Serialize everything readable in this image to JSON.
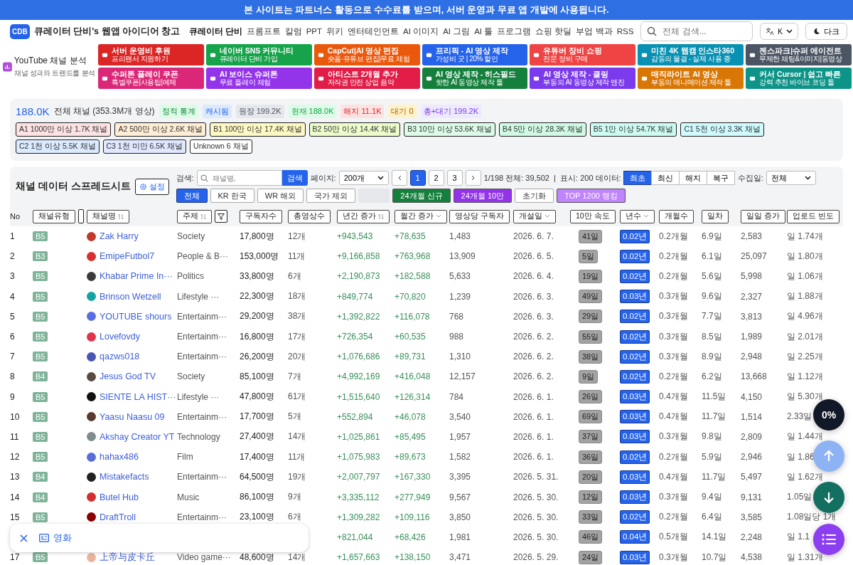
{
  "banner": "본 사이트는 파트너스 활동으로 수수료를 받으며, 서버 운영과 무료 앱 개발에 사용됩니다.",
  "nav": {
    "logo": "CDB",
    "title": "큐레이터 단비's 웹앱 아이디어 창고",
    "links": [
      {
        "label": "큐레이터 단비",
        "bold": true
      },
      {
        "label": "프롬프트",
        "bold": false
      },
      {
        "label": "칼럼",
        "bold": false
      },
      {
        "label": "PPT",
        "bold": false
      },
      {
        "label": "위키",
        "bold": false
      },
      {
        "label": "엔터테인먼트",
        "bold": false
      },
      {
        "label": "AI 이미지",
        "bold": false
      },
      {
        "label": "AI 그림",
        "bold": false
      },
      {
        "label": "AI 툴",
        "bold": false
      },
      {
        "label": "프로그램",
        "bold": false
      },
      {
        "label": "쇼핑 핫딜",
        "bold": false
      },
      {
        "label": "부업 백과",
        "bold": false
      },
      {
        "label": "RSS",
        "bold": false
      }
    ],
    "search_placeholder": "전체 검색...",
    "language": "K",
    "theme_button": "다크"
  },
  "app_card": {
    "title": "YouTube 채널 분석",
    "subtitle": "채널 성과와 트렌드를 분석"
  },
  "promos": [
    {
      "title": "서버 운영비 후원",
      "subtitle": "프리랜서 지원하기",
      "color": "#dc2626"
    },
    {
      "title": "네이버 SNS 커뮤니티",
      "subtitle": "큐레이터 단비 가입",
      "color": "#16a34a"
    },
    {
      "title": "CapCut|AI 영상 편집",
      "subtitle": "숏폼·유튜브 편집|무료 체험",
      "color": "#ea580c"
    },
    {
      "title": "프리픽 - AI 영상 제작",
      "subtitle": "가성비 굿 | 20% 할인",
      "color": "#2563eb"
    },
    {
      "title": "유튜버 장비 쇼핑",
      "subtitle": "전문 장비 구매",
      "color": "#ef4444"
    },
    {
      "title": "미친 4K 웹캠 인스타360",
      "subtitle": "감동의 물결 - 실제 사용 중",
      "color": "#0891b2"
    },
    {
      "title": "젠스파크|슈퍼 에이전트",
      "subtitle": "무제한 채팅&이미지|동영상",
      "color": "#4b5563"
    },
    {
      "title": "수퍼톤 플레이 쿠폰",
      "subtitle": "특별쿠폰|사용팁|예제",
      "color": "#db2777"
    },
    {
      "title": "AI 보이스 슈퍼톤",
      "subtitle": "무료 플레이 체험",
      "color": "#9333ea"
    },
    {
      "title": "아티스트 2개월 추가",
      "subtitle": "저작권 안전 상업 음악",
      "color": "#e11d48"
    },
    {
      "title": "AI 영상 제작 - 히스필드",
      "subtitle": "핫한 AI 동영상 제작 툴",
      "color": "#15803d"
    },
    {
      "title": "AI 영상 제작 - 클링",
      "subtitle": "부동의 AI 동영상 제작 엔진",
      "color": "#7c3aed"
    },
    {
      "title": "매직라이트 AI 영상",
      "subtitle": "부동의 애니메이션 제작 툴",
      "color": "#d97706"
    },
    {
      "title": "커서 Cursor | 쉽고 빠른",
      "subtitle": "강력 추천 바이브 코딩 툴",
      "color": "#0d9488"
    }
  ],
  "stats": {
    "total": "188.0K",
    "total_label": "전체 채널 (353.3M개 영상)",
    "chips": [
      {
        "label": "정적 통계",
        "kind": "static"
      },
      {
        "label": "캐시됨",
        "kind": "cache"
      },
      {
        "label": "원장 199.2K",
        "kind": "ledger"
      },
      {
        "label": "현재 188.0K",
        "kind": "current"
      },
      {
        "label": "해지 11.1K",
        "kind": "cancelled"
      },
      {
        "label": "대기 0",
        "kind": "waiting"
      },
      {
        "label": "총+대기 199.2K",
        "kind": "total"
      }
    ],
    "grades": [
      {
        "label": "A1 1000만 이상 1.7K 채널",
        "color": "#fde2e2"
      },
      {
        "label": "A2 500만 이상 2.6K 채널",
        "color": "#ffedd5"
      },
      {
        "label": "B1 100만 이상 17.4K 채널",
        "color": "#fef9c3"
      },
      {
        "label": "B2 50만 이상 14.4K 채널",
        "color": "#ecfccb"
      },
      {
        "label": "B3 10만 이상 53.6K 채널",
        "color": "#dcfce7"
      },
      {
        "label": "B4 5만 이상 28.3K 채널",
        "color": "#d1fae5"
      },
      {
        "label": "B5 1만 이상 54.7K 채널",
        "color": "#ccfbf1"
      },
      {
        "label": "C1 5천 이상 3.3K 채널",
        "color": "#cffafe"
      },
      {
        "label": "C2 1천 이상 5.5K 채널",
        "color": "#dbeafe"
      },
      {
        "label": "C3 1천 미만 6.5K 채널",
        "color": "#e0e7ff"
      },
      {
        "label": "Unknown 6 채널",
        "color": "#ffffff"
      }
    ]
  },
  "controls": {
    "title": "채널 데이터 스프레드시트",
    "settings": "설정",
    "search_label": "검색:",
    "search_placeholder": "채널명, ",
    "search_button": "검색",
    "page_size_label": "페이지:",
    "page_size": "200개",
    "pages": [
      {
        "label": "1",
        "selected": true
      },
      {
        "label": "2",
        "selected": false
      },
      {
        "label": "3",
        "selected": false
      }
    ],
    "page_info": "1/198 전체: 39,502  |  표시: 200 데이터:",
    "modes": [
      {
        "label": "최초",
        "selected": true
      },
      {
        "label": "최신",
        "selected": false
      },
      {
        "label": "해지",
        "selected": false
      },
      {
        "label": "복구",
        "selected": false
      }
    ],
    "collect_label": "수집일:",
    "collect": "전체",
    "filters": [
      {
        "kind": "plain",
        "label": "전체",
        "selected": true
      },
      {
        "kind": "plain",
        "label": "KR 한국",
        "selected": false
      },
      {
        "kind": "plain",
        "label": "WR 해외",
        "selected": false
      },
      {
        "kind": "plain",
        "label": "국가 제외",
        "selected": false
      },
      {
        "kind": "disabled"
      },
      {
        "kind": "solid",
        "label": "24개월 신규",
        "color": "#15803d"
      },
      {
        "kind": "solid",
        "label": "24개월 10만",
        "color": "#9333ea"
      },
      {
        "kind": "plain",
        "label": "초기화",
        "selected": false
      },
      {
        "kind": "solid",
        "label": "TOP 1200 랭킹",
        "color": "#c084fc"
      }
    ]
  },
  "table": {
    "columns": [
      {
        "label": "No",
        "kind": "plain"
      },
      {
        "label": "채널유형",
        "kind": "button",
        "toggle": true
      },
      {
        "label": "채널명",
        "kind": "button",
        "sortable": true
      },
      {
        "label": "주제",
        "kind": "button",
        "sortable": true,
        "filter": true
      },
      {
        "label": "구독자수",
        "kind": "button"
      },
      {
        "label": "총영상수",
        "kind": "button"
      },
      {
        "label": "년간 증가",
        "kind": "button",
        "sortable": true
      },
      {
        "label": "월간 증가",
        "kind": "button",
        "dropdown": true
      },
      {
        "label": "영상당 구독자",
        "kind": "button"
      },
      {
        "label": "개설일",
        "kind": "button",
        "dropdown": true
      },
      {
        "label": "10만 속도",
        "kind": "button"
      },
      {
        "label": "년수",
        "kind": "button",
        "dropdown": true
      },
      {
        "label": "개월수",
        "kind": "button"
      },
      {
        "label": "일차",
        "kind": "button"
      },
      {
        "label": "일일 증가",
        "kind": "button"
      },
      {
        "label": "업로드 빈도",
        "kind": "button"
      }
    ],
    "rows": [
      {
        "no": "1",
        "grade": "B5",
        "color": "#c0392b",
        "name": "Zak Harry",
        "topic": "Society",
        "subs": "17,800명",
        "videos": "12개",
        "yearly": "+943,543",
        "monthly": "+78,635",
        "per_video": "1,483",
        "opened": "2026. 6. 7.",
        "speed": "41일",
        "years": "0.02년",
        "months": "0.2개월",
        "days": "6.9일",
        "daily": "2,583",
        "upload": "일 1.74개"
      },
      {
        "no": "2",
        "grade": "B3",
        "color": "#d63031",
        "name": "EmipeFutbol7",
        "topic": "People & B···",
        "subs": "153,000명",
        "videos": "11개",
        "yearly": "+9,166,858",
        "monthly": "+763,968",
        "per_video": "13,909",
        "opened": "2026. 6. 5.",
        "speed": "5일",
        "years": "0.02년",
        "months": "0.2개월",
        "days": "6.1일",
        "daily": "25,097",
        "upload": "일 1.80개"
      },
      {
        "no": "3",
        "grade": "B5",
        "color": "#3a3a3a",
        "name": "Khabar Prime In···",
        "topic": "Politics",
        "subs": "33,800명",
        "videos": "6개",
        "yearly": "+2,190,873",
        "monthly": "+182,588",
        "per_video": "5,633",
        "opened": "2026. 6. 4.",
        "speed": "19일",
        "years": "0.02년",
        "months": "0.2개월",
        "days": "5.6일",
        "daily": "5,998",
        "upload": "일 1.06개"
      },
      {
        "no": "4",
        "grade": "B5",
        "color": "#14a3a3",
        "name": "Brinson Wetzell",
        "topic": "Lifestyle ···",
        "subs": "22,300명",
        "videos": "18개",
        "yearly": "+849,774",
        "monthly": "+70,820",
        "per_video": "1,239",
        "opened": "2026. 6. 3.",
        "speed": "49일",
        "years": "0.03년",
        "months": "0.3개월",
        "days": "9.6일",
        "daily": "2,327",
        "upload": "일 1.88개"
      },
      {
        "no": "5",
        "grade": "B5",
        "color": "#5b6ee1",
        "name": "YOUTUBE shours",
        "topic": "Entertainm···",
        "subs": "29,200명",
        "videos": "38개",
        "yearly": "+1,392,822",
        "monthly": "+116,078",
        "per_video": "768",
        "opened": "2026. 6. 3.",
        "speed": "29일",
        "years": "0.02년",
        "months": "0.3개월",
        "days": "7.7일",
        "daily": "3,813",
        "upload": "일 4.96개"
      },
      {
        "no": "6",
        "grade": "B5",
        "color": "#e0344a",
        "name": "Lovefovdy",
        "topic": "Entertainm···",
        "subs": "16,800명",
        "videos": "17개",
        "yearly": "+726,354",
        "monthly": "+60,535",
        "per_video": "988",
        "opened": "2026. 6. 2.",
        "speed": "55일",
        "years": "0.02년",
        "months": "0.3개월",
        "days": "8.5일",
        "daily": "1,989",
        "upload": "일 2.01개"
      },
      {
        "no": "7",
        "grade": "B5",
        "color": "#4a55b5",
        "name": "qazws018",
        "topic": "Entertainm···",
        "subs": "26,200명",
        "videos": "20개",
        "yearly": "+1,076,686",
        "monthly": "+89,731",
        "per_video": "1,310",
        "opened": "2026. 6. 2.",
        "speed": "38일",
        "years": "0.02년",
        "months": "0.3개월",
        "days": "8.9일",
        "daily": "2,948",
        "upload": "일 2.25개"
      },
      {
        "no": "8",
        "grade": "B4",
        "color": "#5a4a44",
        "name": "Jesus God TV",
        "topic": "Society",
        "subs": "85,100명",
        "videos": "7개",
        "yearly": "+4,992,169",
        "monthly": "+416,048",
        "per_video": "12,157",
        "opened": "2026. 6. 2.",
        "speed": "9일",
        "years": "0.02년",
        "months": "0.2개월",
        "days": "6.2일",
        "daily": "13,668",
        "upload": "일 1.12개"
      },
      {
        "no": "9",
        "grade": "B5",
        "color": "#111111",
        "name": "SIENTE LA HIST···",
        "topic": "Lifestyle ···",
        "subs": "47,800명",
        "videos": "61개",
        "yearly": "+1,515,640",
        "monthly": "+126,314",
        "per_video": "784",
        "opened": "2026. 6. 1.",
        "speed": "26일",
        "years": "0.03년",
        "months": "0.4개월",
        "days": "11.5일",
        "daily": "4,150",
        "upload": "일 5.30개"
      },
      {
        "no": "10",
        "grade": "B5",
        "color": "#5b3a2e",
        "name": "Yaasu Naasu 09",
        "topic": "Entertainm···",
        "subs": "17,700명",
        "videos": "5개",
        "yearly": "+552,894",
        "monthly": "+46,078",
        "per_video": "3,540",
        "opened": "2026. 6. 1.",
        "speed": "69일",
        "years": "0.03년",
        "months": "0.4개월",
        "days": "11.7일",
        "daily": "1,514",
        "upload": "2.33일"
      },
      {
        "no": "11",
        "grade": "B5",
        "color": "#7f8c8d",
        "name": "Akshay Creator YT",
        "topic": "Technology",
        "subs": "27,400명",
        "videos": "14개",
        "yearly": "+1,025,861",
        "monthly": "+85,495",
        "per_video": "1,957",
        "opened": "2026. 6. 1.",
        "speed": "37일",
        "years": "0.03년",
        "months": "0.3개월",
        "days": "9.8일",
        "daily": "2,809",
        "upload": "일 1.44개"
      },
      {
        "no": "12",
        "grade": "B5",
        "color": "#5a6fd6",
        "name": "hahax486",
        "topic": "Film",
        "subs": "17,400명",
        "videos": "11개",
        "yearly": "+1,075,983",
        "monthly": "+89,673",
        "per_video": "1,582",
        "opened": "2026. 6. 1.",
        "speed": "36일",
        "years": "0.02년",
        "months": "0.2개월",
        "days": "5.9일",
        "daily": "2,946",
        "upload": "일 1.86"
      },
      {
        "no": "13",
        "grade": "B4",
        "color": "#222222",
        "name": "Mistakefacts",
        "topic": "Entertainm···",
        "subs": "64,500명",
        "videos": "19개",
        "yearly": "+2,007,797",
        "monthly": "+167,330",
        "per_video": "3,395",
        "opened": "2026. 5. 31.",
        "speed": "20일",
        "years": "0.03년",
        "months": "0.4개월",
        "days": "11.7일",
        "daily": "5,497",
        "upload": "일 1.62개"
      },
      {
        "no": "14",
        "grade": "B4",
        "color": "#d32f2f",
        "name": "Butel Hub",
        "topic": "Music",
        "subs": "86,100명",
        "videos": "9개",
        "yearly": "+3,335,112",
        "monthly": "+277,949",
        "per_video": "9,567",
        "opened": "2026. 5. 30.",
        "speed": "12일",
        "years": "0.03년",
        "months": "0.3개월",
        "days": "9.4일",
        "daily": "9,131",
        "upload": "1.05일"
      },
      {
        "no": "15",
        "grade": "B5",
        "color": "#8b0000",
        "name": "DraftTroll",
        "topic": "Entertainm···",
        "subs": "23,100명",
        "videos": "6개",
        "yearly": "+1,309,282",
        "monthly": "+109,116",
        "per_video": "3,850",
        "opened": "2026. 5. 30.",
        "speed": "33일",
        "years": "0.02년",
        "months": "0.2개월",
        "days": "6.4일",
        "daily": "3,585",
        "upload": "1.08일당 1개"
      },
      {
        "yearly": "+821,044",
        "monthly": "+68,426",
        "per_video": "1,981",
        "opened": "2026. 5. 30.",
        "speed": "46일",
        "years": "0.04년",
        "months": "0.5개월",
        "days": "14.1일",
        "daily": "2,248",
        "upload": "일 1.1"
      },
      {
        "no": "17",
        "grade": "B5",
        "color": "#e8b4a0",
        "name": "上帝与皮卡丘",
        "topic": "Video game···",
        "subs": "48,600명",
        "videos": "14개",
        "yearly": "+1,657,663",
        "monthly": "+138,150",
        "per_video": "3,471",
        "opened": "2026. 5. 29.",
        "speed": "24일",
        "years": "0.03년",
        "months": "0.3개월",
        "days": "10.7일",
        "daily": "4,538",
        "upload": "일 1.31개"
      }
    ]
  },
  "popup": {
    "label": "영화"
  },
  "progress": "0%"
}
